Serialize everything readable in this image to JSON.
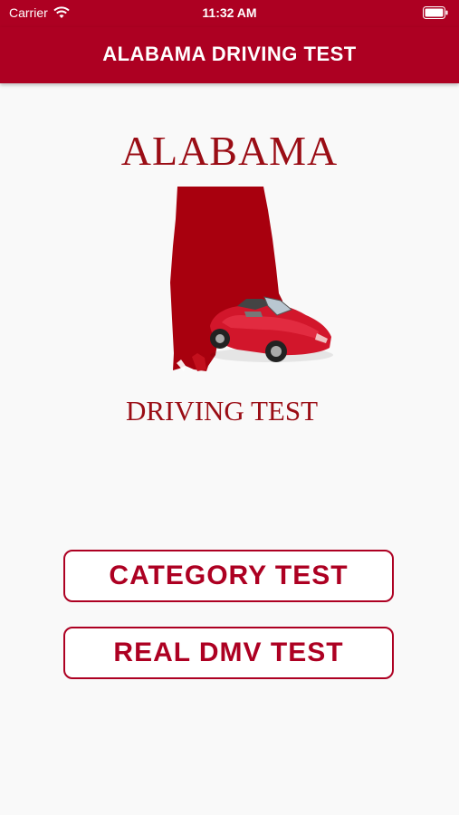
{
  "status_bar": {
    "carrier": "Carrier",
    "time": "11:32 AM"
  },
  "nav": {
    "title": "ALABAMA DRIVING TEST"
  },
  "logo": {
    "title": "ALABAMA",
    "subtitle": "DRIVING TEST"
  },
  "buttons": {
    "category": "CATEGORY TEST",
    "real": "REAL DMV TEST"
  },
  "colors": {
    "brand": "#ad0022",
    "logo_text": "#9a0d15",
    "background": "#f9f9f9"
  },
  "icons": [
    "wifi-icon",
    "battery-icon",
    "alabama-map-icon",
    "car-icon"
  ]
}
